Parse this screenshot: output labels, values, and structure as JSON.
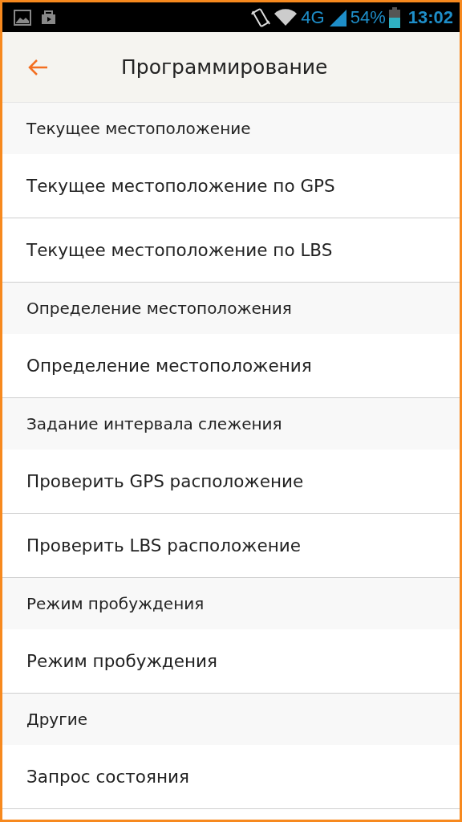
{
  "status_bar": {
    "network": "4G",
    "battery": "54%",
    "time": "13:02"
  },
  "header": {
    "title": "Программирование"
  },
  "sections": [
    {
      "title": "Текущее местоположение",
      "items": [
        {
          "label": "Текущее местоположение по GPS"
        },
        {
          "label": "Текущее местоположение по LBS"
        }
      ]
    },
    {
      "title": "Определение местоположения",
      "items": [
        {
          "label": "Определение местоположения"
        }
      ]
    },
    {
      "title": "Задание интервала слежения",
      "items": [
        {
          "label": "Проверить GPS расположение"
        },
        {
          "label": "Проверить LBS расположение"
        }
      ]
    },
    {
      "title": "Режим пробуждения",
      "items": [
        {
          "label": "Режим пробуждения"
        }
      ]
    },
    {
      "title": "Другие",
      "items": [
        {
          "label": "Запрос состояния"
        }
      ]
    }
  ]
}
